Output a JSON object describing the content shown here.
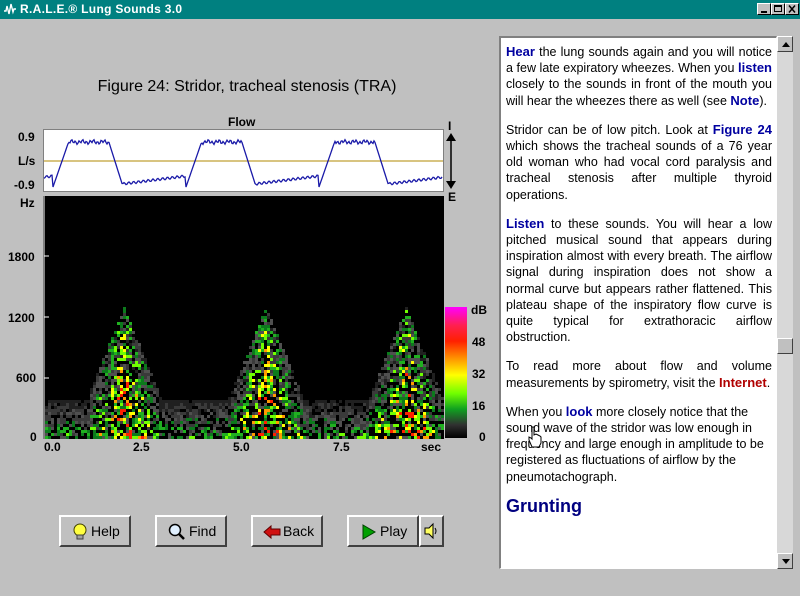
{
  "window": {
    "title": "R.A.L.E.® Lung Sounds 3.0"
  },
  "figure": {
    "title": "Figure 24: Stridor, tracheal stenosis (TRA)",
    "flow_label": "Flow",
    "flow_ticks": {
      "top": "0.9",
      "mid": "L/s",
      "bottom": "-0.9"
    },
    "flow_arrow": {
      "inspiration": "I",
      "expiration": "E"
    },
    "freq_unit": "Hz",
    "freq_ticks": [
      "1800",
      "1200",
      "600",
      "0"
    ],
    "time_ticks": [
      "0.0",
      "2.5",
      "5.0",
      "7.5",
      "sec"
    ],
    "colorbar_unit": "dB",
    "colorbar_ticks": [
      "48",
      "32",
      "16",
      "0"
    ]
  },
  "text": {
    "p1_kw1": "Hear",
    "p1_t1": " the lung sounds again and you will notice a few late expiratory wheezes. When you ",
    "p1_kw2": "listen",
    "p1_t2": " closely to the sounds in front of the mouth you will hear the wheezes there as well (see ",
    "p1_kw3": "Note",
    "p1_t3": ").",
    "p2_t1": "Stridor can be of low pitch. Look at ",
    "p2_kw": "Figure 24",
    "p2_t2": " which shows the tracheal sounds of a 76 year old woman who had vocal cord paralysis and tracheal stenosis after multiple thyroid operations.",
    "p3_kw": "Listen",
    "p3_t1": " to these sounds. You will hear a low pitched musical sound that appears during inspiration almost with every breath. The airflow signal during inspiration does not show a normal curve but appears rather flattened. This plateau shape of the inspiratory flow curve is quite typical for extrathoracic airflow obstruction.",
    "p4_t1": "To read more about flow and volume measurements by spirometry, visit the ",
    "p4_link": "Internet",
    "p4_t2": ".",
    "p5_t1": "When you ",
    "p5_kw": "look",
    "p5_t2": " more closely notice that the sound wave of the stridor was low enough in frequency and large enough in amplitude to be registered as fluctuations of airflow by the pneumotachograph.",
    "heading": "Grunting"
  },
  "buttons": {
    "help": "Help",
    "find": "Find",
    "back": "Back",
    "play": "Play"
  },
  "colors": {
    "titlebar": "#008080",
    "keyword": "#0000a0",
    "link": "#b00000",
    "flow_trace": "#1a1aa8",
    "baseline": "#b08a00"
  }
}
